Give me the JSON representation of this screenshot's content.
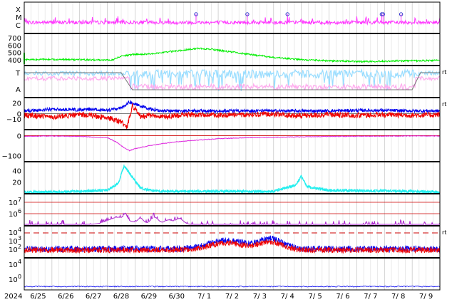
{
  "colors": {
    "xray": "#ff33ff",
    "density": "#00ee00",
    "temp_speed_t": "#99ddff",
    "temp_speed_a": "#ffaaee",
    "mag_bt": "#0000ee",
    "mag_bz": "#ee0000",
    "dst": "#dd22dd",
    "kp": "#22eeee",
    "proton": "#aa22cc",
    "electron_a": "#0000ee",
    "electron_b": "#ee0000",
    "gray_line": "#777777",
    "threshold": "#cc0000"
  },
  "chart_data": [
    {
      "type": "line",
      "panel": "xray",
      "ylabels": [
        "X",
        "M",
        "C"
      ],
      "x_range_days": [
        0,
        15
      ],
      "baseline": "C",
      "flare_markers_days": [
        6.2,
        8.05,
        9.5,
        12.9,
        12.95,
        13.6
      ]
    },
    {
      "type": "line",
      "panel": "density",
      "ytick_labels": [
        "700",
        "600",
        "500",
        "400"
      ],
      "y_ticks": [
        700,
        600,
        500,
        400
      ],
      "ylim": [
        320,
        760
      ],
      "series": [
        {
          "x": [
            0,
            1,
            2,
            3,
            3.2,
            3.5,
            4,
            4.5,
            5,
            5.5,
            6,
            6.3,
            6.6,
            7,
            7.5,
            8,
            8.5,
            9,
            10,
            11,
            12,
            13,
            14,
            15
          ],
          "values": [
            400,
            405,
            400,
            395,
            400,
            450,
            475,
            480,
            500,
            520,
            545,
            555,
            548,
            530,
            505,
            480,
            455,
            430,
            400,
            385,
            375,
            380,
            385,
            390
          ]
        }
      ]
    },
    {
      "type": "line",
      "panel": "temperature",
      "ylabels": [
        "T",
        "A"
      ],
      "right_label": "rt",
      "gray_step": {
        "x": [
          0,
          3.5,
          3.9,
          14,
          14.3,
          15
        ],
        "level": [
          "high",
          "high",
          "low",
          "low",
          "high",
          "high"
        ]
      }
    },
    {
      "type": "line",
      "panel": "imf",
      "ytick_labels": [
        "20",
        "0",
        "−10"
      ],
      "y_ticks": [
        20,
        0,
        -10
      ],
      "ylim": [
        -30,
        30
      ],
      "right_label": "rt",
      "series": [
        {
          "x": [
            0,
            1,
            2,
            2.5,
            3,
            3.5,
            3.8,
            4,
            4.5,
            5,
            6,
            7,
            8,
            9,
            10,
            11,
            12,
            13,
            14,
            15
          ],
          "values": [
            5,
            8,
            7,
            8,
            6,
            10,
            22,
            18,
            9,
            5,
            5,
            5,
            5,
            5,
            5,
            5,
            6,
            6,
            5,
            5
          ]
        },
        {
          "x": [
            0,
            1,
            2,
            2.5,
            3,
            3.5,
            3.7,
            3.9,
            4.2,
            4.5,
            5,
            6,
            7,
            8,
            9,
            10,
            11,
            12,
            13,
            14,
            15
          ],
          "values": [
            -3,
            -6,
            -2,
            -4,
            -8,
            -15,
            -28,
            15,
            -5,
            -4,
            -6,
            -2,
            -3,
            -2,
            -1,
            -4,
            -2,
            -3,
            -2,
            -3,
            -2
          ]
        }
      ]
    },
    {
      "type": "line",
      "panel": "dst",
      "ytick_labels": [
        "0",
        "−100"
      ],
      "y_ticks": [
        0,
        -100
      ],
      "ylim": [
        -130,
        30
      ],
      "series": [
        {
          "x": [
            0,
            1,
            2,
            3,
            3.3,
            3.6,
            3.8,
            4,
            4.5,
            5,
            5.5,
            6,
            7,
            8,
            9,
            10,
            11,
            12,
            13,
            14,
            15
          ],
          "values": [
            -3,
            -2,
            -4,
            -10,
            -30,
            -60,
            -75,
            -65,
            -50,
            -40,
            -30,
            -25,
            -15,
            -10,
            -8,
            -6,
            -4,
            -3,
            -2,
            -2,
            -2
          ]
        }
      ]
    },
    {
      "type": "line",
      "panel": "kp",
      "ytick_labels": [
        "40",
        "20"
      ],
      "y_ticks": [
        40,
        20
      ],
      "ylim": [
        0,
        55
      ],
      "series": [
        {
          "x": [
            0,
            1,
            2,
            3,
            3.4,
            3.6,
            3.8,
            4,
            4.2,
            4.5,
            5,
            6,
            7,
            8,
            9,
            9.8,
            10,
            10.2,
            11,
            12,
            13,
            14,
            15
          ],
          "values": [
            3,
            3,
            4,
            6,
            18,
            48,
            35,
            22,
            10,
            6,
            4,
            4,
            4,
            4,
            4,
            15,
            30,
            12,
            6,
            5,
            5,
            4,
            3
          ]
        }
      ]
    },
    {
      "type": "line",
      "panel": "proton",
      "ytick_labels": [
        "10",
        "10"
      ],
      "ytick_exponents": [
        "7",
        "6"
      ],
      "log_scale": true,
      "thresholds": [
        "1e7",
        "1e6"
      ]
    },
    {
      "type": "line",
      "panel": "electron",
      "ytick_labels": [
        "10",
        "10",
        "10"
      ],
      "ytick_exponents": [
        "4",
        "3",
        "2"
      ],
      "log_scale": true,
      "right_label": "rt"
    },
    {
      "type": "line",
      "panel": "electron_low",
      "ytick_labels": [
        "10",
        "10"
      ],
      "ytick_exponents": [
        "4",
        "0"
      ],
      "log_scale": true
    }
  ],
  "x_axis": {
    "year": "2024",
    "labels": [
      "6/25",
      "6/26",
      "6/27",
      "6/28",
      "6/29",
      "6/30",
      "7/ 1",
      "7/ 2",
      "7/ 3",
      "7/ 4",
      "7/ 5",
      "7/ 6",
      "7/ 7",
      "7/ 8",
      "7/ 9"
    ]
  }
}
